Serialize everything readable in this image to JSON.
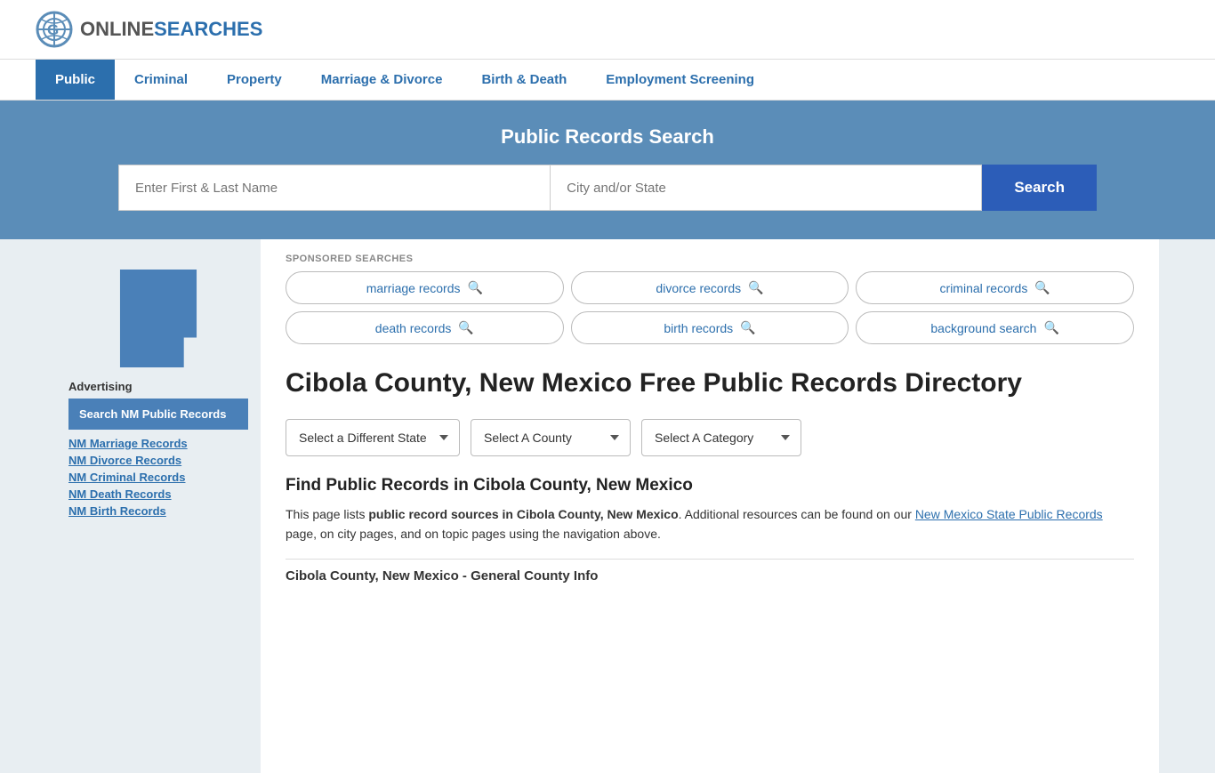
{
  "header": {
    "logo_online": "ONLINE",
    "logo_searches": "SEARCHES"
  },
  "nav": {
    "items": [
      {
        "label": "Public",
        "active": true
      },
      {
        "label": "Criminal",
        "active": false
      },
      {
        "label": "Property",
        "active": false
      },
      {
        "label": "Marriage & Divorce",
        "active": false
      },
      {
        "label": "Birth & Death",
        "active": false
      },
      {
        "label": "Employment Screening",
        "active": false
      }
    ]
  },
  "search_band": {
    "title": "Public Records Search",
    "name_placeholder": "Enter First & Last Name",
    "city_placeholder": "City and/or State",
    "button_label": "Search"
  },
  "sponsored": {
    "label": "SPONSORED SEARCHES",
    "tags": [
      "marriage records",
      "divorce records",
      "criminal records",
      "death records",
      "birth records",
      "background search"
    ]
  },
  "county": {
    "title": "Cibola County, New Mexico Free Public Records Directory"
  },
  "dropdowns": {
    "state_label": "Select a Different State",
    "county_label": "Select A County",
    "category_label": "Select A Category"
  },
  "find_records": {
    "title": "Find Public Records in Cibola County, New Mexico",
    "para": "This page lists ",
    "bold": "public record sources in Cibola County, New Mexico",
    "para2": ". Additional resources can be found on our ",
    "link": "New Mexico State Public Records",
    "para3": " page, on city pages, and on topic pages using the navigation above.",
    "county_info_title": "Cibola County, New Mexico - General County Info"
  },
  "sidebar": {
    "advertising_label": "Advertising",
    "ad_box": "Search NM Public Records",
    "links": [
      "NM Marriage Records",
      "NM Divorce Records",
      "NM Criminal Records",
      "NM Death Records",
      "NM Birth Records"
    ]
  }
}
